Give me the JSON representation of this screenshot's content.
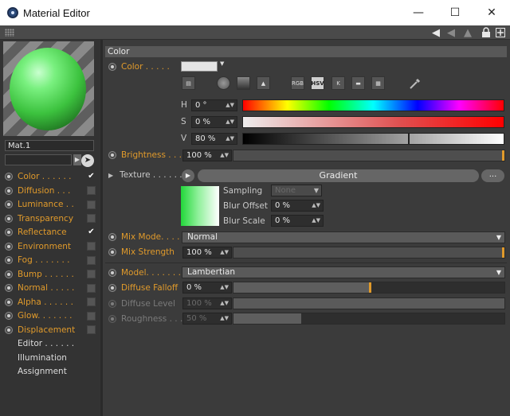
{
  "window": {
    "title": "Material Editor",
    "minimize_glyph": "—",
    "maximize_glyph": "☐",
    "close_glyph": "✕"
  },
  "toolbar": {
    "icons": [
      "grid-grip-icon",
      "back-arrow-icon",
      "forward-arrow-icon",
      "up-arrow-icon",
      "lock-icon",
      "new-panel-icon"
    ]
  },
  "material": {
    "name": "Mat.1",
    "preview_colors": {
      "sphere": "#4fd957",
      "checker_light": "#8a8a8a",
      "checker_dark": "#5e5e5e"
    }
  },
  "channels": [
    {
      "label": "Color . . . . . .",
      "checked": true,
      "check_glyph": "✔",
      "enabled": true
    },
    {
      "label": "Diffusion . . .",
      "checked": false,
      "check_glyph": "",
      "enabled": true
    },
    {
      "label": "Luminance . .",
      "checked": false,
      "check_glyph": "",
      "enabled": true
    },
    {
      "label": "Transparency",
      "checked": false,
      "check_glyph": "",
      "enabled": true
    },
    {
      "label": "Reflectance",
      "checked": true,
      "check_glyph": "✔",
      "enabled": true
    },
    {
      "label": "Environment",
      "checked": false,
      "check_glyph": "",
      "enabled": true
    },
    {
      "label": "Fog . . . . . . .",
      "checked": false,
      "check_glyph": "",
      "enabled": true
    },
    {
      "label": "Bump . . . . . .",
      "checked": false,
      "check_glyph": "",
      "enabled": true
    },
    {
      "label": "Normal . . . . .",
      "checked": false,
      "check_glyph": "",
      "enabled": true
    },
    {
      "label": "Alpha . . . . . .",
      "checked": false,
      "check_glyph": "",
      "enabled": true
    },
    {
      "label": "Glow. . . . . . .",
      "checked": false,
      "check_glyph": "",
      "enabled": true
    },
    {
      "label": "Displacement",
      "checked": false,
      "check_glyph": "",
      "enabled": true
    },
    {
      "label": "Editor . . . . . .",
      "checked": null,
      "enabled": true
    },
    {
      "label": "Illumination",
      "checked": null,
      "enabled": true
    },
    {
      "label": "Assignment",
      "checked": null,
      "enabled": true
    }
  ],
  "section": {
    "title": "Color"
  },
  "color": {
    "label": "Color . . . . .",
    "swatch": "#e4e4e4",
    "mode_buttons": [
      "RGB",
      "HSV",
      "K",
      "",
      ""
    ],
    "selected_mode": "HSV",
    "h": {
      "label": "H",
      "value": "0 °"
    },
    "s": {
      "label": "S",
      "value": "0 %"
    },
    "v": {
      "label": "V",
      "value": "80 %",
      "level": 0.8
    }
  },
  "brightness": {
    "label": "Brightness . . . .",
    "value": "100 %",
    "level": 1.0
  },
  "texture": {
    "label": "Texture . . . . . .",
    "shader": "Gradient",
    "ellipsis": "...",
    "sampling_label": "Sampling",
    "sampling_value": "None",
    "blur_offset_label": "Blur Offset",
    "blur_offset_value": "0 %",
    "blur_scale_label": "Blur Scale",
    "blur_scale_value": "0 %"
  },
  "mix_mode": {
    "label": "Mix Mode. . . .",
    "value": "Normal"
  },
  "mix_strength": {
    "label": "Mix Strength",
    "value": "100 %",
    "level": 1.0
  },
  "model": {
    "label": "Model. . . . . . . .",
    "value": "Lambertian"
  },
  "diffuse_falloff": {
    "label": "Diffuse Falloff",
    "value": "0 %",
    "level": 0.5
  },
  "diffuse_level": {
    "label": "Diffuse Level",
    "value": "100 %",
    "level": 1.0
  },
  "roughness": {
    "label": "Roughness . . . .",
    "value": "50 %",
    "level": 0.25
  }
}
